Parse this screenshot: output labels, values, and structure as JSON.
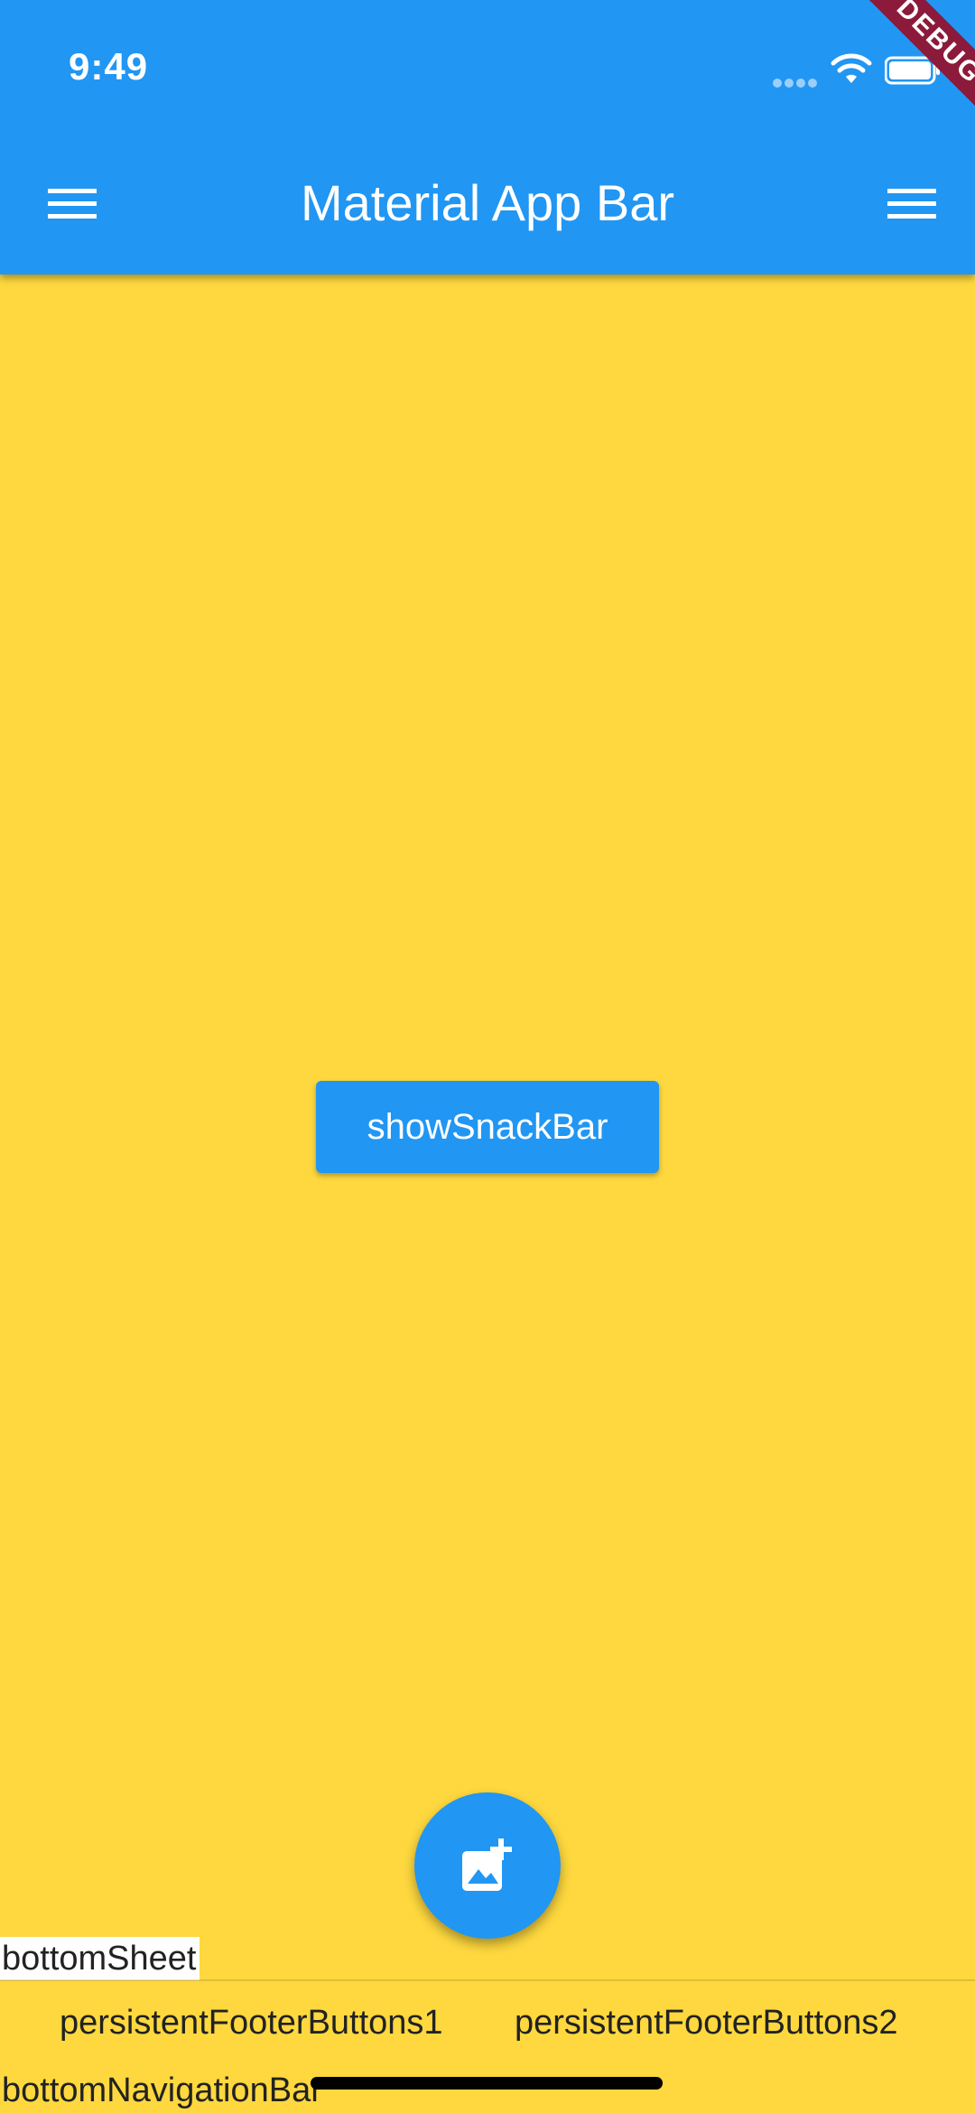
{
  "status_bar": {
    "time": "9:49"
  },
  "debug_banner": {
    "label": "DEBUG"
  },
  "app_bar": {
    "title": "Material App Bar",
    "leading_icon": "menu-icon",
    "action_icon": "menu-icon"
  },
  "body": {
    "snackbar_button_label": "showSnackBar"
  },
  "fab": {
    "icon": "add-photo-icon"
  },
  "bottom_sheet": {
    "label": "bottomSheet"
  },
  "footer": {
    "buttons": [
      "persistentFooterButtons1",
      "persistentFooterButtons2"
    ]
  },
  "bottom_navigation": {
    "label": "bottomNavigationBar"
  },
  "colors": {
    "primary": "#2196F3",
    "background": "#FED83E",
    "debug": "#8B1A3B"
  }
}
